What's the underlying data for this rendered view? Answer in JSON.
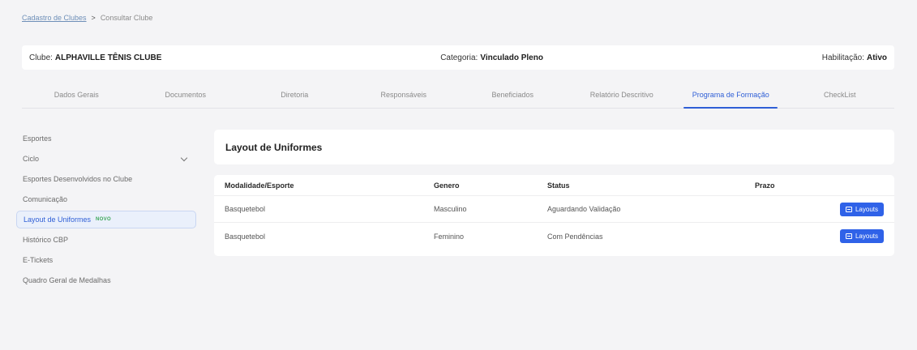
{
  "breadcrumb": {
    "parent": "Cadastro de Clubes",
    "separator": ">",
    "current": "Consultar Clube"
  },
  "club_info": {
    "club_label": "Clube:",
    "club_name": "ALPHAVILLE TÊNIS CLUBE",
    "category_label": "Categoria:",
    "category_value": "Vinculado Pleno",
    "status_label": "Habilitação:",
    "status_value": "Ativo"
  },
  "tabs": [
    {
      "label": "Dados Gerais",
      "active": false
    },
    {
      "label": "Documentos",
      "active": false
    },
    {
      "label": "Diretoria",
      "active": false
    },
    {
      "label": "Responsáveis",
      "active": false
    },
    {
      "label": "Beneficiados",
      "active": false
    },
    {
      "label": "Relatório Descritivo",
      "active": false
    },
    {
      "label": "Programa de Formação",
      "active": true
    },
    {
      "label": "CheckList",
      "active": false
    }
  ],
  "sidebar": {
    "items": [
      {
        "label": "Esportes"
      },
      {
        "label": "Ciclo"
      },
      {
        "label": "Esportes Desenvolvidos no Clube"
      },
      {
        "label": "Comunicação"
      },
      {
        "label": "Layout de Uniformes",
        "badge": "NOVO"
      },
      {
        "label": "Histórico CBP"
      },
      {
        "label": "E-Tickets"
      },
      {
        "label": "Quadro Geral de Medalhas"
      }
    ]
  },
  "main": {
    "title": "Layout de Uniformes",
    "table": {
      "headers": [
        "Modalidade/Esporte",
        "Genero",
        "Status",
        "Prazo"
      ],
      "rows": [
        {
          "sport": "Basquetebol",
          "gender": "Masculino",
          "status": "Aguardando Validação",
          "deadline": "",
          "action": "Layouts"
        },
        {
          "sport": "Basquetebol",
          "gender": "Feminino",
          "status": "Com Pendências",
          "deadline": "",
          "action": "Layouts"
        }
      ]
    }
  },
  "colors": {
    "accent": "#2f5fd6",
    "button": "#2f62e8",
    "badge_new": "#3aa657",
    "background": "#f4f4f6"
  },
  "icons": {
    "button_icon": "layout-icon",
    "ciclo_expand": "chevron-down-icon"
  }
}
